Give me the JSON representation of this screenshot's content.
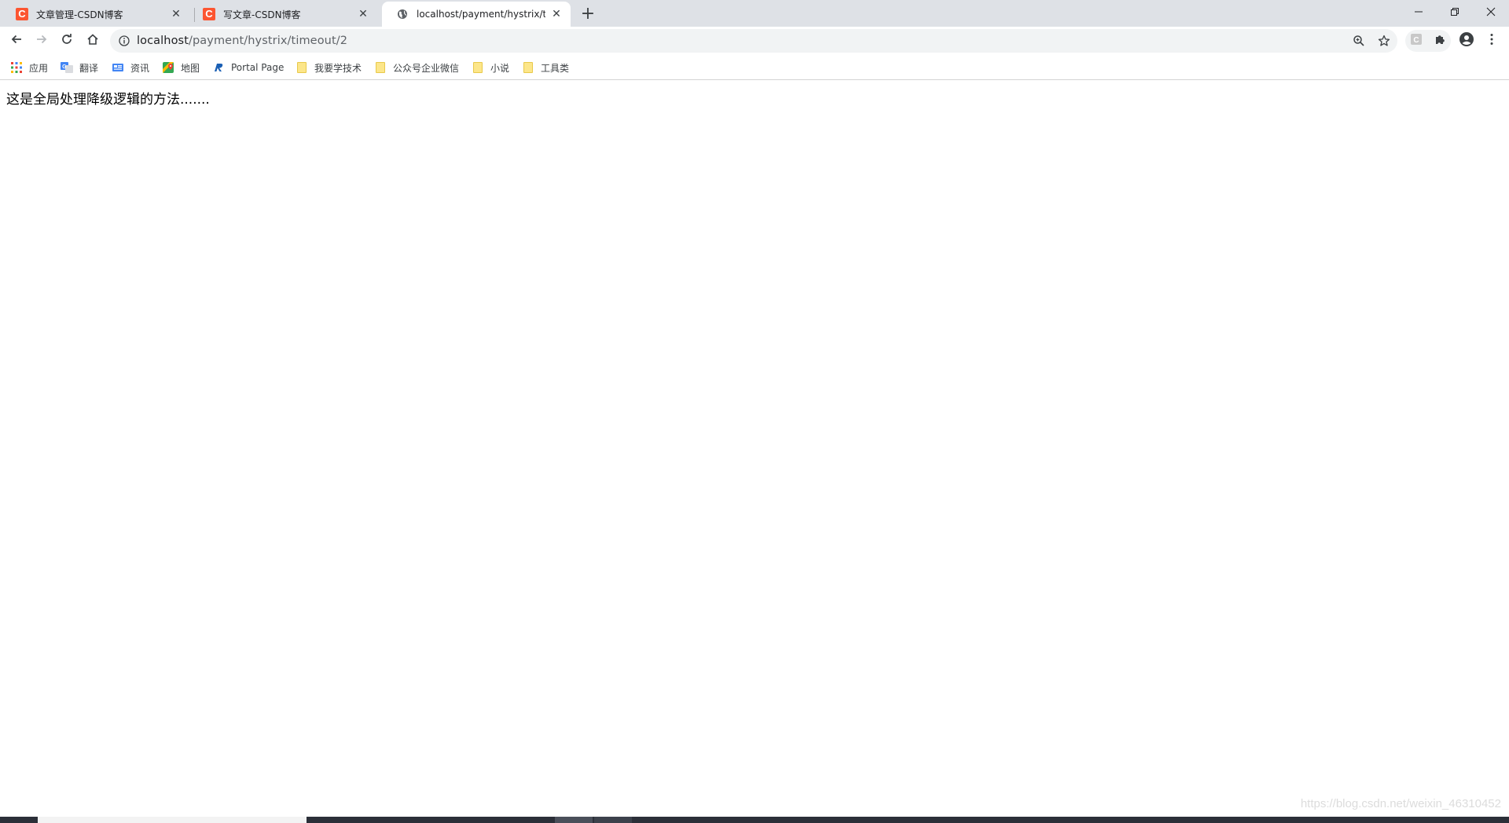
{
  "tabs": [
    {
      "title": "文章管理-CSDN博客",
      "icon": "csdn-icon",
      "active": false
    },
    {
      "title": "写文章-CSDN博客",
      "icon": "csdn-icon",
      "active": false
    },
    {
      "title": "localhost/payment/hystrix/tim",
      "icon": "globe-icon",
      "active": true
    }
  ],
  "window_controls": {
    "minimize": "─",
    "restore": "❐",
    "close": "✕"
  },
  "address_bar": {
    "host": "localhost",
    "path": "/payment/hystrix/timeout/2"
  },
  "bookmarks": [
    {
      "label": "应用",
      "icon": "apps-grid-icon"
    },
    {
      "label": "翻译",
      "icon": "translate-icon"
    },
    {
      "label": "资讯",
      "icon": "news-icon"
    },
    {
      "label": "地图",
      "icon": "maps-icon"
    },
    {
      "label": "Portal Page",
      "icon": "portal-icon"
    },
    {
      "label": "我要学技术",
      "icon": "folder-icon"
    },
    {
      "label": "公众号企业微信",
      "icon": "folder-icon"
    },
    {
      "label": "小说",
      "icon": "folder-icon"
    },
    {
      "label": "工具类",
      "icon": "folder-icon"
    }
  ],
  "page": {
    "message": "这是全局处理降级逻辑的方法......."
  },
  "watermark": "https://blog.csdn.net/weixin_46310452",
  "colors": {
    "tabstrip": "#dee1e6",
    "csdn": "#fc5531",
    "omnibox": "#f1f3f4",
    "taskbar": "#2b2f38"
  }
}
